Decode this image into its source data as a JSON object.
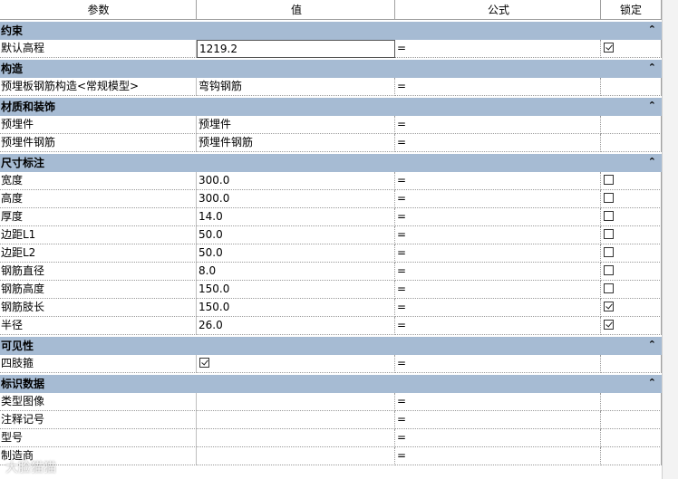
{
  "header": {
    "param": "参数",
    "value": "值",
    "formula": "公式",
    "lock": "锁定"
  },
  "groups": [
    {
      "title": "约束",
      "collapse": "⌃",
      "rows": [
        {
          "name": "默认高程",
          "value": "1219.2",
          "formula": "=",
          "lock": "checked"
        }
      ]
    },
    {
      "title": "构造",
      "collapse": "⌃",
      "rows": [
        {
          "name": "预埋板钢筋构造<常规模型>",
          "value": "弯钩钢筋",
          "formula": "=",
          "lock": "none"
        }
      ]
    },
    {
      "title": "材质和装饰",
      "collapse": "⌃",
      "rows": [
        {
          "name": "预埋件",
          "value": "预埋件",
          "formula": "=",
          "lock": "none"
        },
        {
          "name": "预埋件钢筋",
          "value": "预埋件钢筋",
          "formula": "=",
          "lock": "none"
        }
      ]
    },
    {
      "title": "尺寸标注",
      "collapse": "⌃",
      "rows": [
        {
          "name": "宽度",
          "value": "300.0",
          "formula": "=",
          "lock": "unchecked"
        },
        {
          "name": "高度",
          "value": "300.0",
          "formula": "=",
          "lock": "unchecked"
        },
        {
          "name": "厚度",
          "value": "14.0",
          "formula": "=",
          "lock": "unchecked"
        },
        {
          "name": "边距L1",
          "value": "50.0",
          "formula": "=",
          "lock": "unchecked"
        },
        {
          "name": "边距L2",
          "value": "50.0",
          "formula": "=",
          "lock": "unchecked"
        },
        {
          "name": "钢筋直径",
          "value": "8.0",
          "formula": "=",
          "lock": "unchecked"
        },
        {
          "name": "钢筋高度",
          "value": "150.0",
          "formula": "=",
          "lock": "unchecked"
        },
        {
          "name": "钢筋肢长",
          "value": "150.0",
          "formula": "=",
          "lock": "checked"
        },
        {
          "name": "半径",
          "value": "26.0",
          "formula": "=",
          "lock": "checked"
        }
      ]
    },
    {
      "title": "可见性",
      "collapse": "⌃",
      "rows": [
        {
          "name": "四肢箍",
          "value": "",
          "valueCheckbox": "checked",
          "formula": "=",
          "lock": "none"
        }
      ]
    },
    {
      "title": "标识数据",
      "collapse": "⌃",
      "rows": [
        {
          "name": "类型图像",
          "value": "",
          "formula": "=",
          "lock": "none"
        },
        {
          "name": "注释记号",
          "value": "",
          "formula": "=",
          "lock": "none"
        },
        {
          "name": "型号",
          "value": "",
          "formula": "=",
          "lock": "none"
        },
        {
          "name": "制造商",
          "value": "",
          "formula": "=",
          "lock": "none"
        }
      ]
    }
  ],
  "watermark": "大脸猫猫"
}
